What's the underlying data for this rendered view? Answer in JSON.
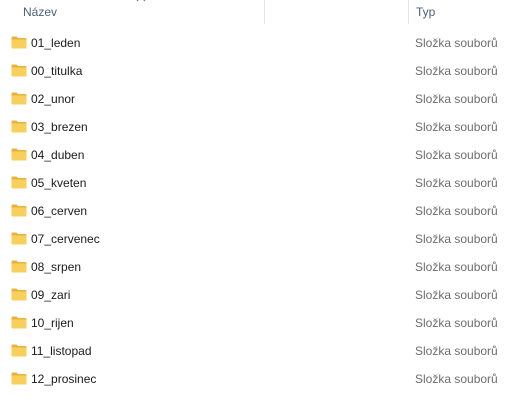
{
  "columns": {
    "name_label": "Název",
    "type_label": "Typ"
  },
  "files": [
    {
      "name": "01_leden",
      "type": "Složka souborů",
      "icon": "folder-icon"
    },
    {
      "name": "00_titulka",
      "type": "Složka souborů",
      "icon": "folder-icon"
    },
    {
      "name": "02_unor",
      "type": "Složka souborů",
      "icon": "folder-icon"
    },
    {
      "name": "03_brezen",
      "type": "Složka souborů",
      "icon": "folder-icon"
    },
    {
      "name": "04_duben",
      "type": "Složka souborů",
      "icon": "folder-icon"
    },
    {
      "name": "05_kveten",
      "type": "Složka souborů",
      "icon": "folder-icon"
    },
    {
      "name": "06_cerven",
      "type": "Složka souborů",
      "icon": "folder-icon"
    },
    {
      "name": "07_cervenec",
      "type": "Složka souborů",
      "icon": "folder-icon"
    },
    {
      "name": "08_srpen",
      "type": "Složka souborů",
      "icon": "folder-icon"
    },
    {
      "name": "09_zari",
      "type": "Složka souborů",
      "icon": "folder-icon"
    },
    {
      "name": "10_rijen",
      "type": "Složka souborů",
      "icon": "folder-icon"
    },
    {
      "name": "11_listopad",
      "type": "Složka souborů",
      "icon": "folder-icon"
    },
    {
      "name": "12_prosinec",
      "type": "Složka souborů",
      "icon": "folder-icon"
    }
  ],
  "colors": {
    "header_text": "#4c607a",
    "folder_back": "#e8b33a",
    "folder_front": "#f8cf5a",
    "type_text": "#6d6d6d"
  }
}
